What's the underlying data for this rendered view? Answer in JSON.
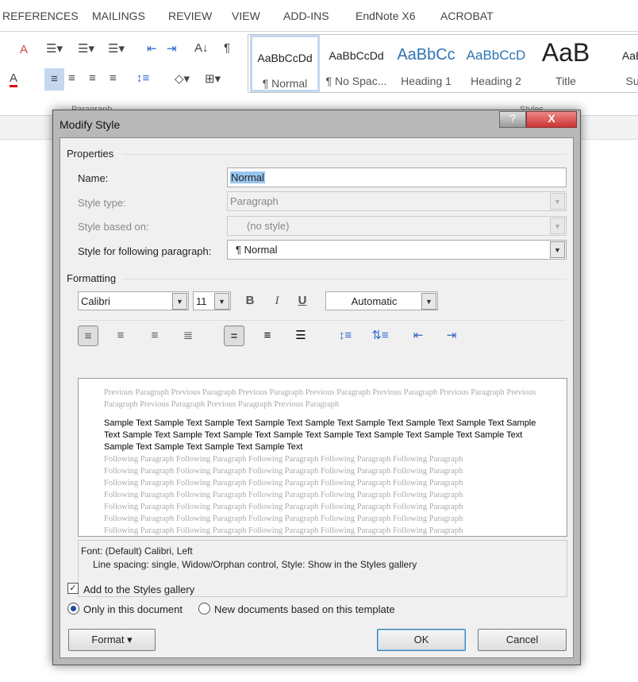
{
  "ribbon": {
    "tabs": [
      "REFERENCES",
      "MAILINGS",
      "REVIEW",
      "VIEW",
      "ADD-INS",
      "EndNote X6",
      "ACROBAT"
    ],
    "group_labels": {
      "paragraph": "Paragraph",
      "styles": "Styles"
    },
    "styles": [
      {
        "preview": "AaBbCcDd",
        "name": "¶ Normal"
      },
      {
        "preview": "AaBbCcDd",
        "name": "¶ No Spac..."
      },
      {
        "preview": "AaBbCc",
        "name": "Heading 1"
      },
      {
        "preview": "AaBbCcD",
        "name": "Heading 2"
      },
      {
        "preview": "AaB",
        "name": "Title"
      },
      {
        "preview": "AaBb",
        "name": "Sub"
      }
    ]
  },
  "dialog": {
    "title": "Modify Style",
    "help": "?",
    "close": "X",
    "properties": {
      "heading": "Properties",
      "name_label": "Name:",
      "name_value": "Normal",
      "style_type_label": "Style type:",
      "style_type_value": "Paragraph",
      "based_on_label": "Style based on:",
      "based_on_value": "(no style)",
      "following_label": "Style for following paragraph:",
      "following_value": "¶  Normal"
    },
    "formatting": {
      "heading": "Formatting",
      "font": "Calibri",
      "size": "11",
      "bold": "B",
      "italic": "I",
      "underline": "U",
      "color": "Automatic"
    },
    "preview": {
      "previous": "Previous Paragraph Previous Paragraph Previous Paragraph Previous Paragraph Previous Paragraph Previous Paragraph Previous Paragraph Previous Paragraph Previous Paragraph Previous Paragraph",
      "sample": "Sample Text Sample Text Sample Text Sample Text Sample Text Sample Text Sample Text Sample Text Sample Text Sample Text Sample Text Sample Text Sample Text Sample Text Sample Text Sample Text Sample Text Sample Text Sample Text Sample Text Sample Text",
      "following": [
        "Following Paragraph Following Paragraph Following Paragraph Following Paragraph Following Paragraph",
        "Following Paragraph Following Paragraph Following Paragraph Following Paragraph Following Paragraph",
        "Following Paragraph Following Paragraph Following Paragraph Following Paragraph Following Paragraph",
        "Following Paragraph Following Paragraph Following Paragraph Following Paragraph Following Paragraph",
        "Following Paragraph Following Paragraph Following Paragraph Following Paragraph Following Paragraph",
        "Following Paragraph Following Paragraph Following Paragraph Following Paragraph Following Paragraph",
        "Following Paragraph Following Paragraph Following Paragraph Following Paragraph Following Paragraph"
      ]
    },
    "description": {
      "line1": "Font: (Default) Calibri, Left",
      "line2": "Line spacing:  single, Widow/Orphan control, Style: Show in the Styles gallery"
    },
    "add_to_gallery": {
      "label": "Add to the Styles gallery",
      "checked": true
    },
    "scope": {
      "only_this": "Only in this document",
      "new_docs": "New documents based on this template",
      "selected": "only_this"
    },
    "buttons": {
      "format": "Format ▾",
      "ok": "OK",
      "cancel": "Cancel"
    }
  }
}
